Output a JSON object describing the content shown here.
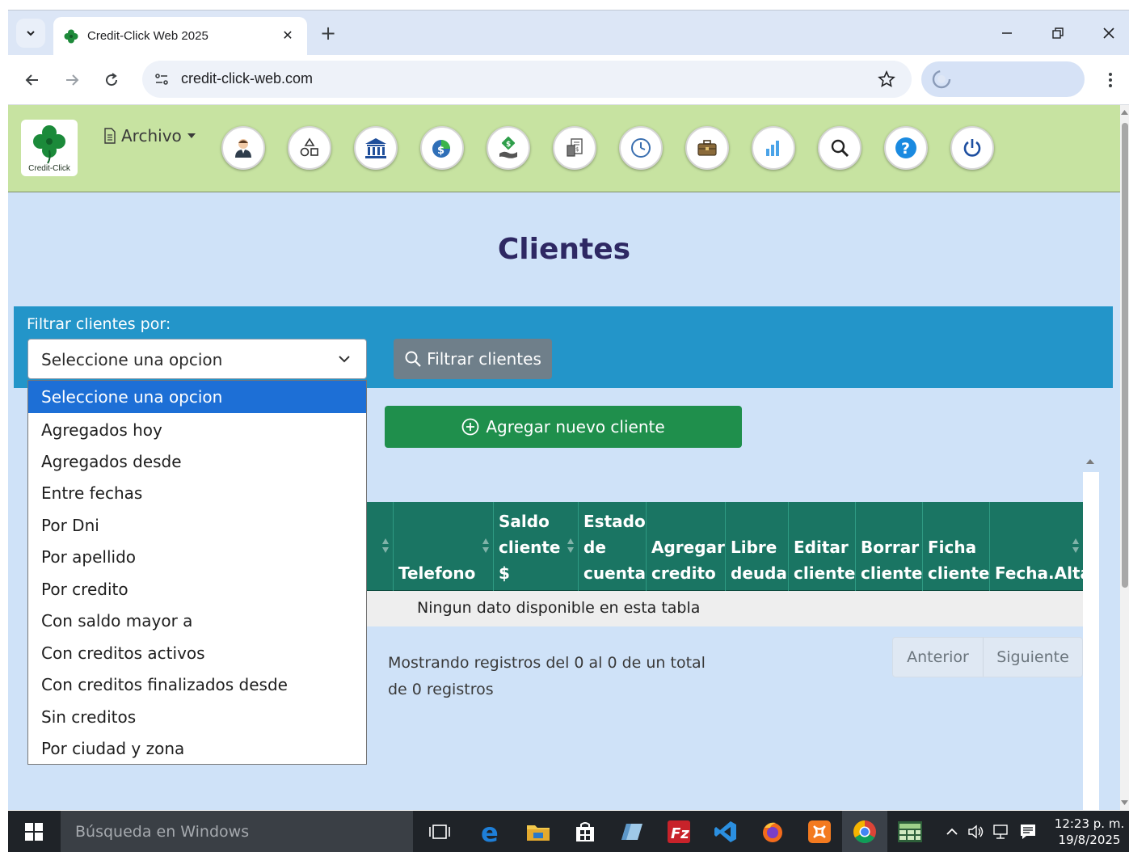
{
  "browser": {
    "tab_title": "Credit-Click Web 2025",
    "tab_close": "✕",
    "new_tab": "+",
    "url": "credit-click-web.com"
  },
  "app": {
    "logo_text": "Credit-Click",
    "archivo_label": "Archivo"
  },
  "page": {
    "title": "Clientes",
    "filter_label": "Filtrar clientes por:",
    "select_value": "Seleccione una opcion",
    "filter_button": "Filtrar clientes",
    "add_button": "Agregar nuevo cliente",
    "empty_table_message": "Ningun dato disponible en esta tabla",
    "records_info": "Mostrando registros del 0 al 0 de un total de 0 registros",
    "pager": {
      "prev": "Anterior",
      "next": "Siguiente"
    }
  },
  "table": {
    "columns": [
      [
        "Telefono"
      ],
      [
        "Saldo",
        "cliente",
        "$"
      ],
      [
        "Estado",
        "de",
        "cuenta"
      ],
      [
        "Agregar",
        "credito"
      ],
      [
        "Libre",
        "deuda"
      ],
      [
        "Editar",
        "cliente"
      ],
      [
        "Borrar",
        "cliente"
      ],
      [
        "Ficha",
        "cliente"
      ],
      [
        "Fecha.Alta"
      ]
    ]
  },
  "dropdown": {
    "options": [
      "Seleccione una opcion",
      "Agregados hoy",
      "Agregados desde",
      "Entre fechas",
      "Por Dni",
      "Por apellido",
      "Por credito",
      "Con saldo mayor a",
      "Con creditos activos",
      "Con creditos finalizados desde",
      "Sin creditos",
      "Por ciudad y zona"
    ]
  },
  "taskbar": {
    "search_placeholder": "Búsqueda en Windows",
    "time": "12:23 p. m.",
    "date": "19/8/2025"
  },
  "colors": {
    "header_bg": "#c7e3a1",
    "page_bg": "#cfe2f8",
    "filter_bar": "#2395c9",
    "add_button": "#1f8f4c",
    "table_header": "#1a7563",
    "title_color": "#2e2863",
    "selected_option": "#1d6fd6"
  }
}
